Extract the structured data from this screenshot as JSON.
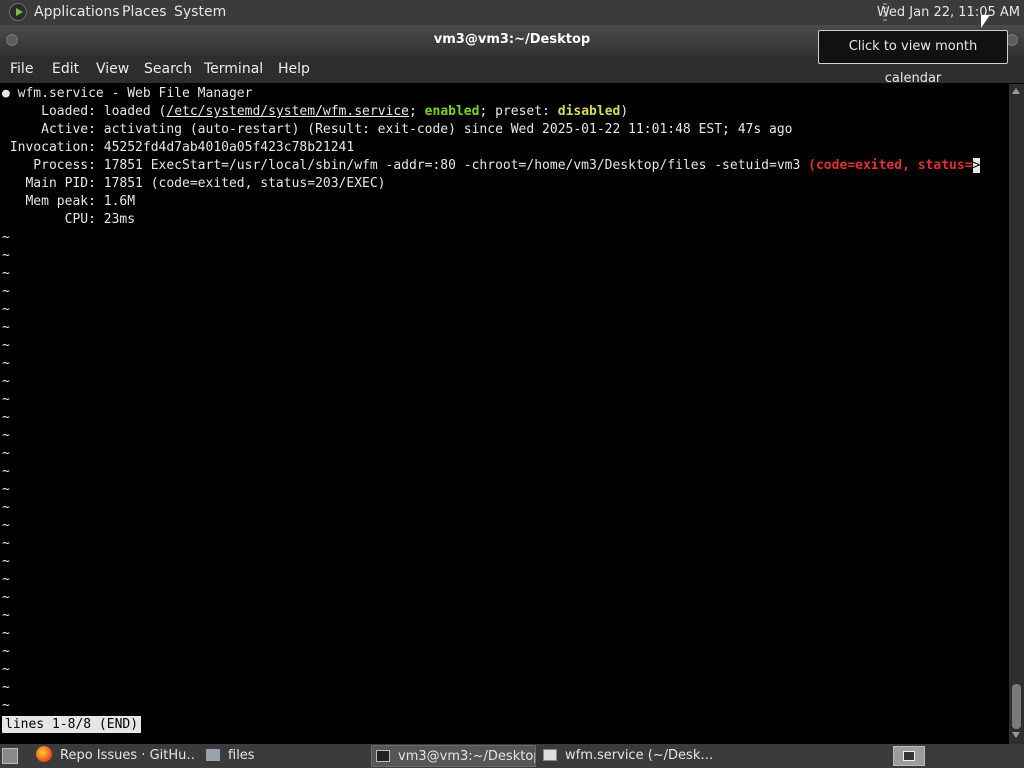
{
  "top_panel": {
    "applications": "Applications",
    "places": "Places",
    "system": "System",
    "clock": "Wed Jan 22, 11:05 AM"
  },
  "tooltip": "Click to view month calendar",
  "window": {
    "title": "vm3@vm3:~/Desktop",
    "menu": [
      "File",
      "Edit",
      "View",
      "Search",
      "Terminal",
      "Help"
    ]
  },
  "terminal": {
    "l1": "● wfm.service - Web File Manager",
    "l2_a": "     Loaded: loaded (",
    "l2_path": "/etc/systemd/system/wfm.service",
    "l2_b": "; ",
    "l2_enabled": "enabled",
    "l2_c": "; preset: ",
    "l2_disabled": "disabled",
    "l2_d": ")",
    "l3": "     Active: activating (auto-restart) (Result: exit-code) since Wed 2025-01-22 11:01:48 EST; 47s ago",
    "l4": " Invocation: 45252fd4d7ab4010a05f423c78b21241",
    "l5_a": "    Process: 17851 ExecStart=/usr/local/sbin/wfm -addr=:80 -chroot=/home/vm3/Desktop/files -setuid=vm3 ",
    "l5_red": "(code=exited, status=",
    "l5_arrow": ">",
    "l6": "   Main PID: 17851 (code=exited, status=203/EXEC)",
    "l7": "   Mem peak: 1.6M",
    "l8": "        CPU: 23ms",
    "tilde": "~",
    "status": "lines 1-8/8 (END)"
  },
  "taskbar": {
    "items": [
      {
        "label": "Repo Issues · GitHu…",
        "icon": "firefox-icon"
      },
      {
        "label": "files",
        "icon": "folder-icon"
      },
      {
        "label": "vm3@vm3:~/Desktop",
        "icon": "terminal-icon"
      },
      {
        "label": "wfm.service (~/Desk…",
        "icon": "text-editor-icon"
      }
    ]
  }
}
